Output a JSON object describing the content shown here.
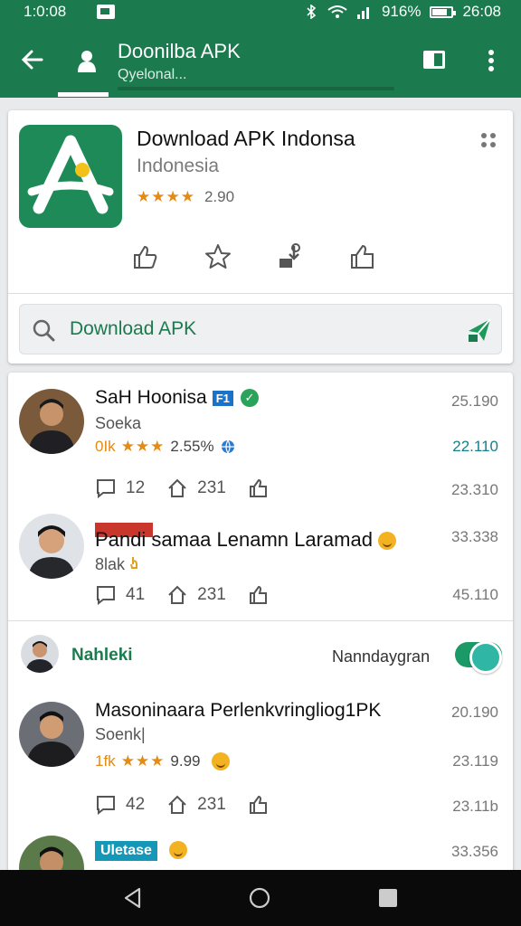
{
  "status_bar": {
    "time": "1:0:08",
    "battery": "916%",
    "clock": "26:08"
  },
  "app_bar": {
    "title": "Doonilba APK",
    "subtitle": "Qyelonal...",
    "back_icon": "back-arrow-icon",
    "more_icon": "more-vert-icon"
  },
  "app_card": {
    "name": "Download APK Indonsa",
    "region": "Indonesia",
    "stars": "★★★★",
    "rating": "2.90",
    "search_text": "Download APK"
  },
  "posts": [
    {
      "name": "SaH Hoonisa",
      "badge": "F1",
      "sub": "Soeka",
      "meta_prefix": "0Ik",
      "stars": "★★★",
      "meta_value": "2.55%",
      "time1": "25.190",
      "time2": "22.110",
      "time3": "23.310",
      "likes": "12",
      "shares": "231"
    },
    {
      "name": "Pandi samaa Lenamn Laramad",
      "sub": "8lak",
      "time1": "33.338",
      "time3": "45.110",
      "likes": "41",
      "shares": "231"
    },
    {
      "name": "Masoninaara Perlenkvringliog1PK",
      "sub": "Soenk|",
      "meta_prefix": "1fk",
      "stars": "★★★",
      "meta_value": "9.99",
      "time1": "20.190",
      "time2": "23.119",
      "time3": "23.11b",
      "likes": "42",
      "shares": "231"
    }
  ],
  "section": {
    "title": "Nahleki",
    "right": "Nanndaygran"
  },
  "last_post": {
    "badge": "Uletase",
    "time": "33.356"
  },
  "colors": {
    "primary": "#1b7a4e",
    "accent_star": "#e58a12",
    "teal": "#13818a"
  }
}
